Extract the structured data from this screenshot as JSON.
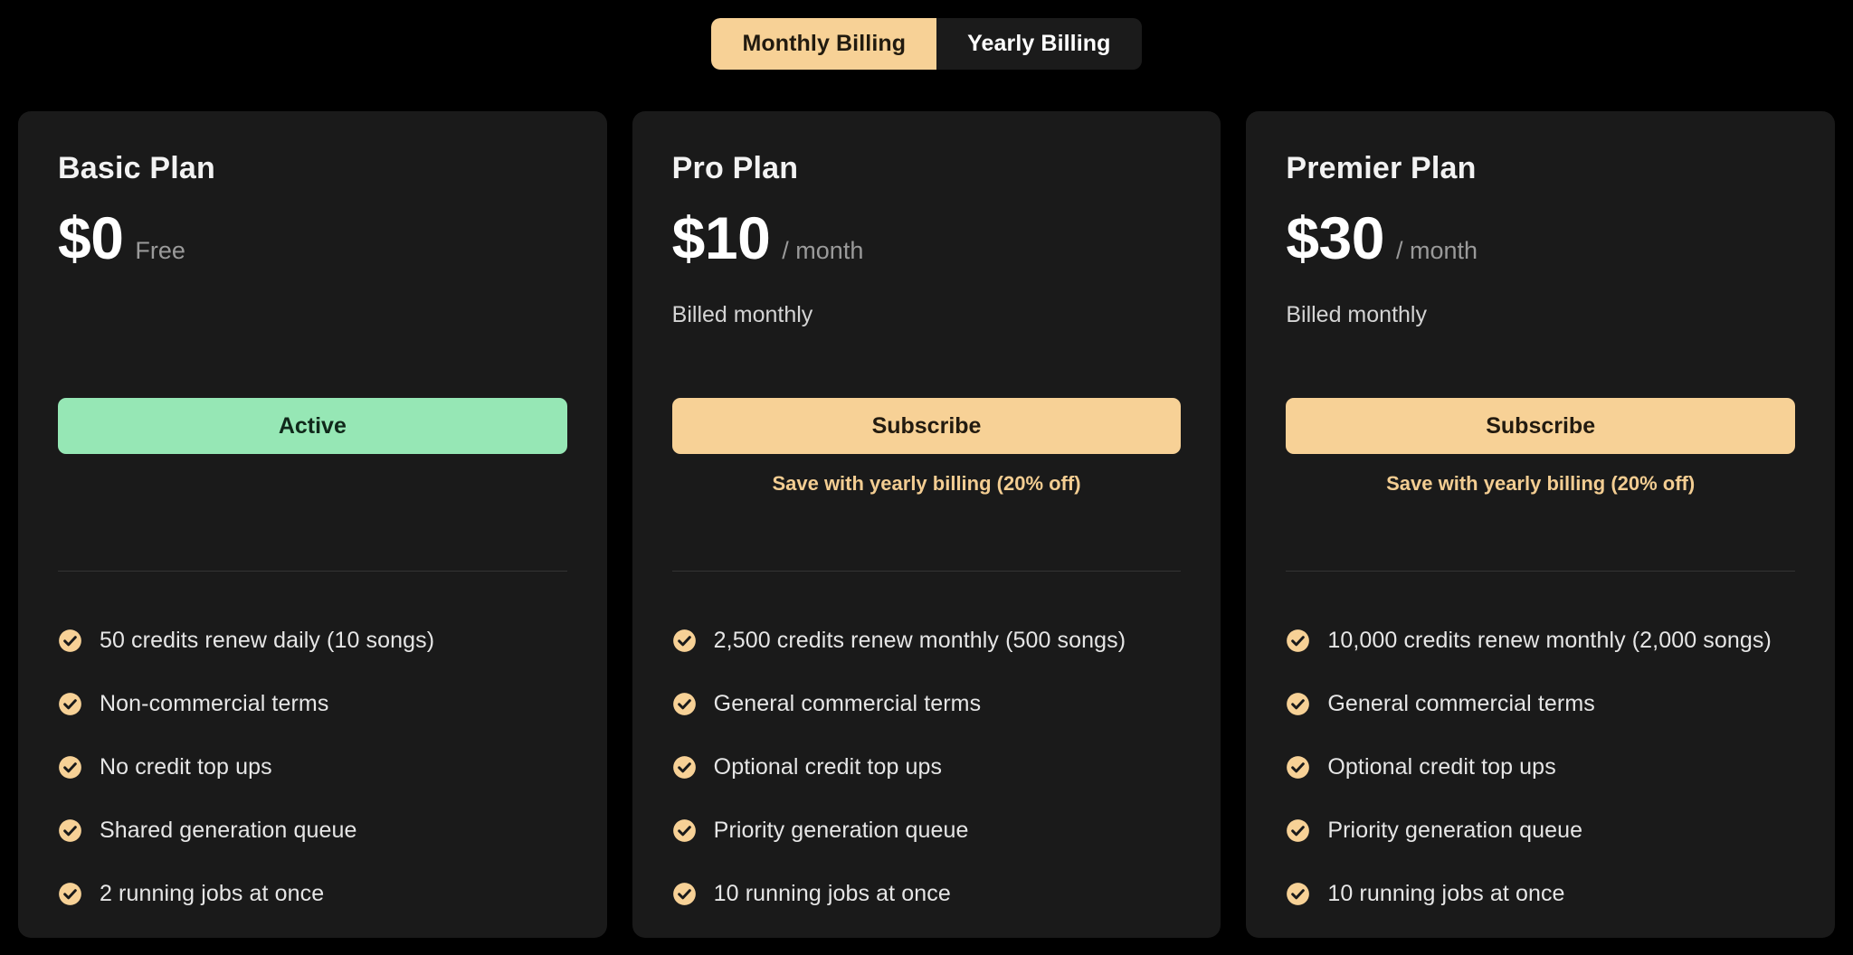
{
  "billing_toggle": {
    "monthly_label": "Monthly Billing",
    "yearly_label": "Yearly Billing",
    "selected": "Monthly Billing",
    "active_bg": "#f7d196",
    "inactive_bg": "#1b1b1b"
  },
  "theme": {
    "page_bg": "#000000",
    "card_bg": "#1a1a1a",
    "accent": "#f7d196",
    "active_green": "#96e7b5",
    "divider": "#333333"
  },
  "plans": [
    {
      "name": "Basic Plan",
      "price": "$0",
      "price_suffix": "Free",
      "billed_note": "",
      "cta_label": "Active",
      "cta_style": "active-plan",
      "save_note": "",
      "features": [
        "50 credits renew daily (10 songs)",
        "Non-commercial terms",
        "No credit top ups",
        "Shared generation queue",
        "2 running jobs at once"
      ]
    },
    {
      "name": "Pro Plan",
      "price": "$10",
      "price_suffix": "/ month",
      "billed_note": "Billed monthly",
      "cta_label": "Subscribe",
      "cta_style": "subscribe",
      "save_note": "Save with yearly billing (20% off)",
      "features": [
        "2,500 credits renew monthly (500 songs)",
        "General commercial terms",
        "Optional credit top ups",
        "Priority generation queue",
        "10 running jobs at once"
      ]
    },
    {
      "name": "Premier Plan",
      "price": "$30",
      "price_suffix": "/ month",
      "billed_note": "Billed monthly",
      "cta_label": "Subscribe",
      "cta_style": "subscribe",
      "save_note": "Save with yearly billing (20% off)",
      "features": [
        "10,000 credits renew monthly (2,000 songs)",
        "General commercial terms",
        "Optional credit top ups",
        "Priority generation queue",
        "10 running jobs at once"
      ]
    }
  ],
  "icons": {
    "check": "check-circle-icon"
  }
}
